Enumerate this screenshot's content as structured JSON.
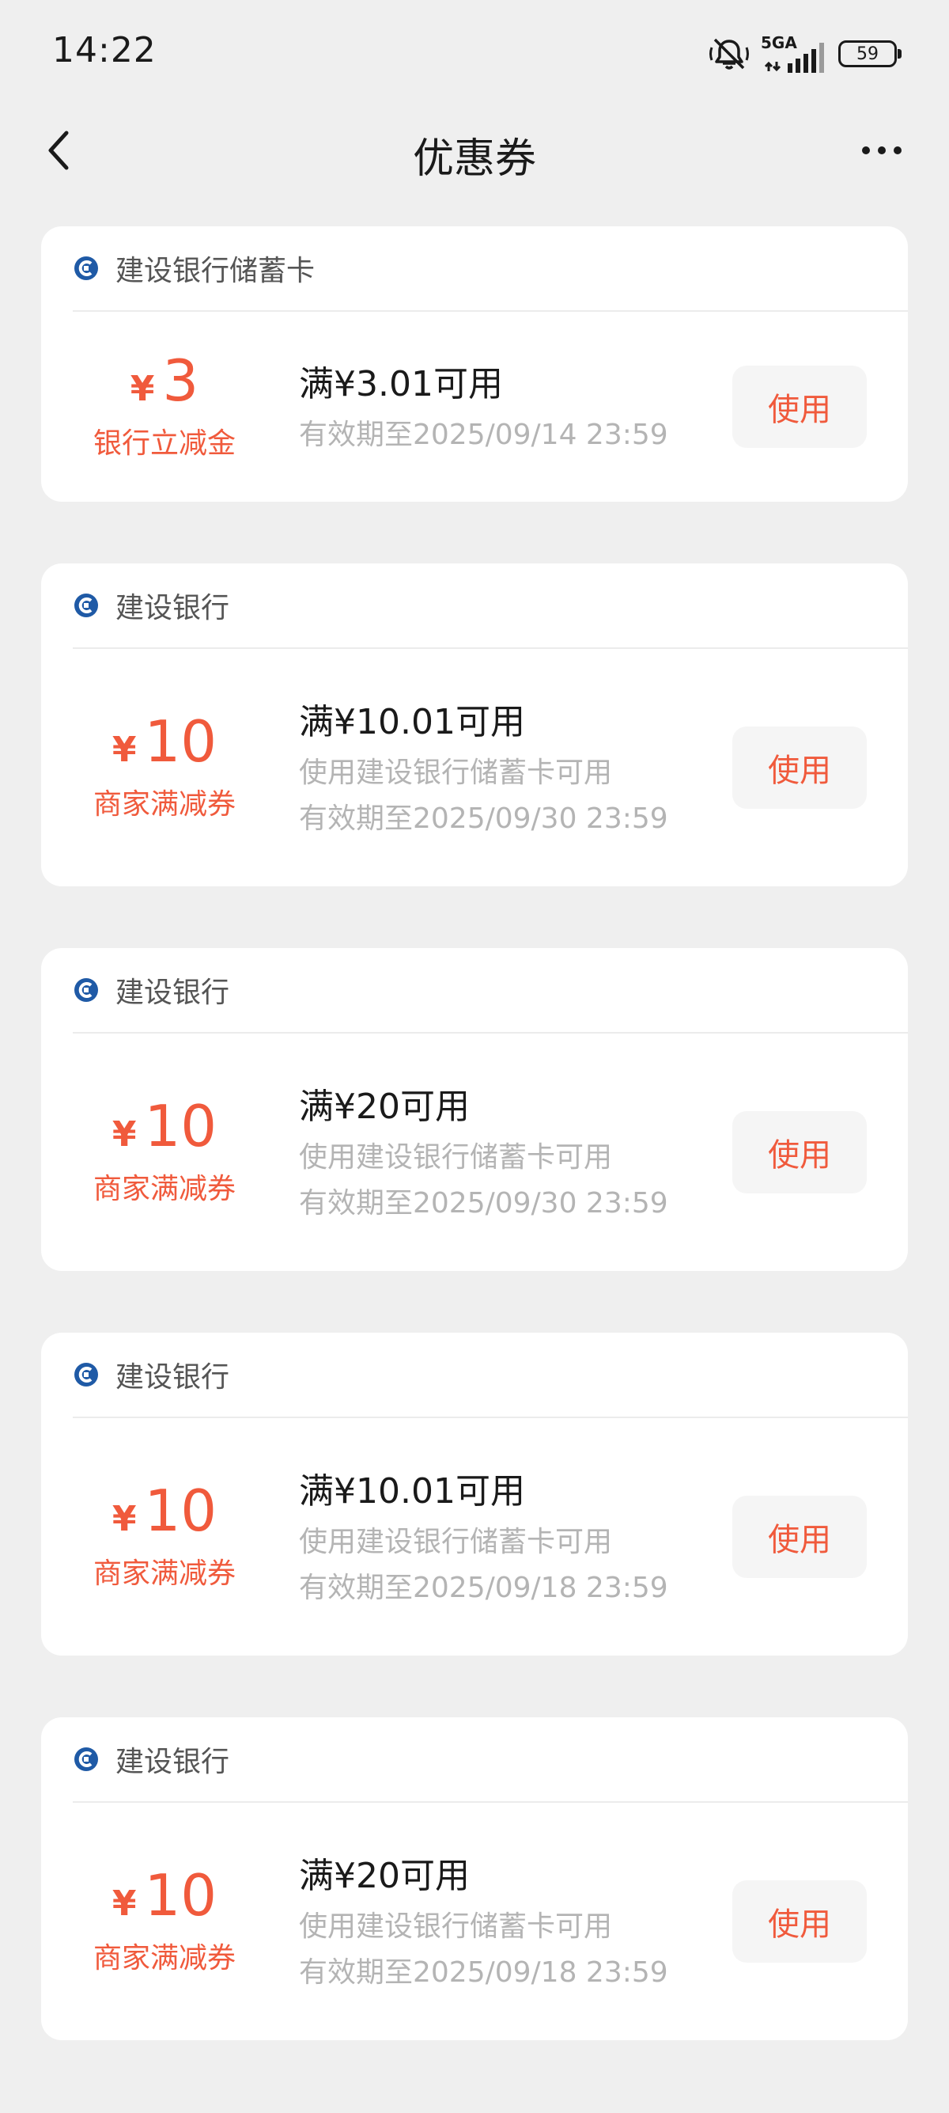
{
  "status_bar": {
    "time": "14:22",
    "network": "5GA",
    "battery": "59"
  },
  "header": {
    "title": "优惠券"
  },
  "icons": {
    "back": "chevron-left-icon",
    "more": "more-horizontal-icon",
    "bank": "ccb-logo-icon"
  },
  "colors": {
    "accent": "#f05a3c",
    "bank_blue": "#1f5aa6",
    "background": "#efefef"
  },
  "coupons": [
    {
      "bank": "建设银行储蓄卡",
      "symbol": "¥",
      "amount": "3",
      "type": "银行立减金",
      "condition": "满¥3.01可用",
      "restriction": "",
      "validity": "有效期至2025/09/14 23:59",
      "button": "使用"
    },
    {
      "bank": "建设银行",
      "symbol": "¥",
      "amount": "10",
      "type": "商家满减券",
      "condition": "满¥10.01可用",
      "restriction": "使用建设银行储蓄卡可用",
      "validity": "有效期至2025/09/30 23:59",
      "button": "使用"
    },
    {
      "bank": "建设银行",
      "symbol": "¥",
      "amount": "10",
      "type": "商家满减券",
      "condition": "满¥20可用",
      "restriction": "使用建设银行储蓄卡可用",
      "validity": "有效期至2025/09/30 23:59",
      "button": "使用"
    },
    {
      "bank": "建设银行",
      "symbol": "¥",
      "amount": "10",
      "type": "商家满减券",
      "condition": "满¥10.01可用",
      "restriction": "使用建设银行储蓄卡可用",
      "validity": "有效期至2025/09/18 23:59",
      "button": "使用"
    },
    {
      "bank": "建设银行",
      "symbol": "¥",
      "amount": "10",
      "type": "商家满减券",
      "condition": "满¥20可用",
      "restriction": "使用建设银行储蓄卡可用",
      "validity": "有效期至2025/09/18 23:59",
      "button": "使用"
    }
  ]
}
